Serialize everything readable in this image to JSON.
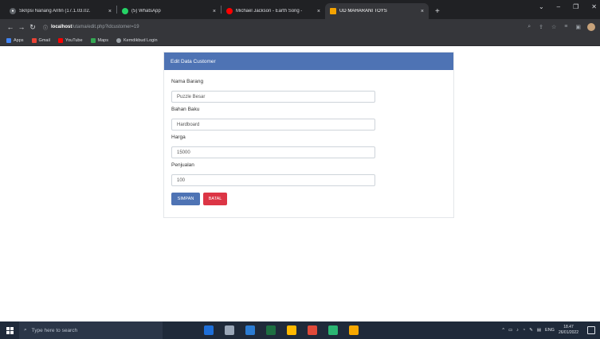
{
  "browser": {
    "tabs": [
      {
        "title": "Skripsi Nanang Arifin (17.1.03.02.",
        "color": "#5f6368"
      },
      {
        "title": "(5) WhatsApp",
        "color": "#25d366"
      },
      {
        "title": "Michael Jackson - Earth Song - ",
        "color": "#ff0000"
      },
      {
        "title": "UD MAHARANI TOYS",
        "color": "#f4a300"
      }
    ],
    "tab_close": "×",
    "new_tab": "+",
    "address": {
      "host": "localhost",
      "path": "/utama/edit.php?idcustomer=19"
    },
    "bookmarks": [
      {
        "label": "Apps",
        "color": "#4285f4"
      },
      {
        "label": "Gmail",
        "color": "#ea4335"
      },
      {
        "label": "YouTube",
        "color": "#ff0000"
      },
      {
        "label": "Maps",
        "color": "#34a853"
      },
      {
        "label": "Kemdikbud Login",
        "color": "#9aa0a6"
      }
    ]
  },
  "form": {
    "header": "Edit Data Customer",
    "fields": [
      {
        "label": "Nama Barang",
        "value": "Puzzle Besar"
      },
      {
        "label": "Bahan Baku",
        "value": "Hardboard"
      },
      {
        "label": "Harga",
        "value": "15000"
      },
      {
        "label": "Penjualan",
        "value": "100"
      }
    ],
    "save_label": "SIMPAN",
    "cancel_label": "BATAL"
  },
  "taskbar": {
    "search_placeholder": "Type here to search",
    "apps": [
      "#1e6fd9",
      "#9aa7b8",
      "#2b7cd3",
      "#1d6f42",
      "#ffb900",
      "#e04a3a",
      "#2bb673",
      "#f7a800"
    ],
    "lang": "ENG",
    "time": "18.47",
    "date": "26/01/2022"
  }
}
